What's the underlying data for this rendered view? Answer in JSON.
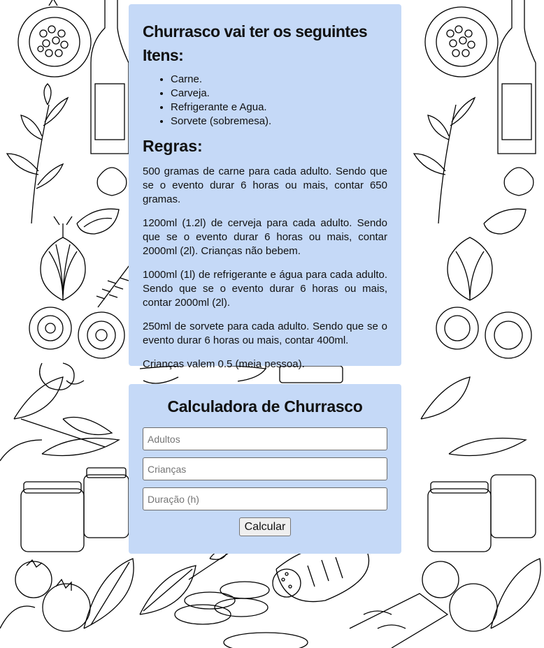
{
  "items": {
    "title": "Churrasco vai ter os seguintes Itens:",
    "list": [
      "Carne.",
      "Carveja.",
      "Refrigerante e Agua.",
      "Sorvete (sobremesa)."
    ]
  },
  "rules": {
    "title": "Regras:",
    "paragraphs": [
      "500 gramas de carne para cada adulto. Sendo que se o evento durar 6 horas ou mais, contar 650 gramas.",
      "1200ml (1.2l) de cerveja para cada adulto. Sendo que se o evento durar 6 horas ou mais, contar 2000ml (2l). Crianças não bebem.",
      "1000ml (1l) de refrigerante e água para cada adulto. Sendo que se o evento durar 6 horas ou mais, contar 2000ml (2l).",
      "250ml de sorvete para cada adulto. Sendo que se o evento durar 6 horas ou mais, contar 400ml.",
      "Crianças valem 0.5 (meia pessoa)."
    ]
  },
  "calculator": {
    "title": "Calculadora de Churrasco",
    "adults_placeholder": "Adultos",
    "kids_placeholder": "Crianças",
    "duration_placeholder": "Duração (h)",
    "button_label": "Calcular"
  },
  "colors": {
    "card_background": "#c5d9f7",
    "page_background": "#ffffff",
    "doodle_stroke": "#000000"
  },
  "background": {
    "pattern": "food-doodle-line-art"
  }
}
